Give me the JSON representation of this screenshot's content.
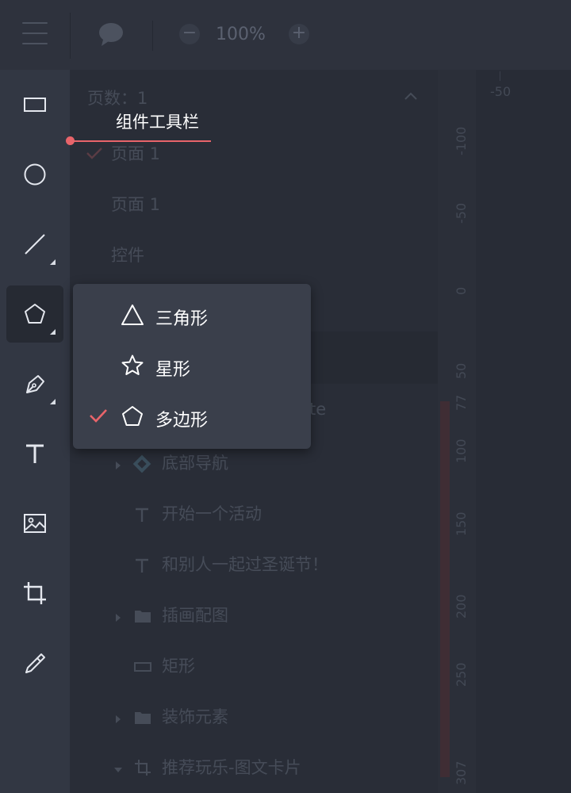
{
  "topbar": {
    "zoom_out": "−",
    "zoom_level": "100%",
    "zoom_in": "+"
  },
  "toolbar": {
    "tools": [
      {
        "name": "rectangle-tool",
        "icon": "rectangle-icon"
      },
      {
        "name": "ellipse-tool",
        "icon": "circle-icon"
      },
      {
        "name": "line-tool",
        "icon": "line-icon"
      },
      {
        "name": "polygon-tool",
        "icon": "pentagon-icon",
        "active": true
      },
      {
        "name": "pen-tool",
        "icon": "pen-icon"
      },
      {
        "name": "text-tool",
        "icon": "text-icon"
      },
      {
        "name": "image-tool",
        "icon": "image-icon"
      },
      {
        "name": "crop-tool",
        "icon": "crop-icon"
      },
      {
        "name": "eyedropper-tool",
        "icon": "eyedropper-icon"
      }
    ]
  },
  "tooltip": {
    "label": "组件工具栏"
  },
  "panel": {
    "page_count": "页数：1",
    "pages": [
      "页面 1",
      "页面 1"
    ],
    "section": "控件",
    "partial_text": "te",
    "layers": [
      {
        "label": "底部导航",
        "icon": "component-icon"
      },
      {
        "label": "开始一个活动",
        "icon": "text-layer-icon"
      },
      {
        "label": "和别人一起过圣诞节！",
        "icon": "text-layer-icon"
      },
      {
        "label": "插画配图",
        "icon": "folder-icon"
      },
      {
        "label": "矩形",
        "icon": "rectangle-layer-icon"
      },
      {
        "label": "装饰元素",
        "icon": "folder-icon"
      },
      {
        "label": "推荐玩乐-图文卡片",
        "icon": "artboard-icon"
      }
    ]
  },
  "ruler": {
    "top_label": "-50",
    "labels": [
      "-100",
      "-50",
      "0",
      "50",
      "77",
      "100",
      "150",
      "200",
      "250",
      "307"
    ]
  },
  "dropdown": {
    "items": [
      {
        "label": "三角形",
        "icon": "triangle-icon",
        "checked": false
      },
      {
        "label": "星形",
        "icon": "star-icon",
        "checked": false
      },
      {
        "label": "多边形",
        "icon": "pentagon-icon",
        "checked": true
      }
    ]
  },
  "colors": {
    "accent": "#e8646a",
    "toolbar_bg": "#323743",
    "panel_bg": "#292d37",
    "dropdown_bg": "#3a3f4b"
  }
}
